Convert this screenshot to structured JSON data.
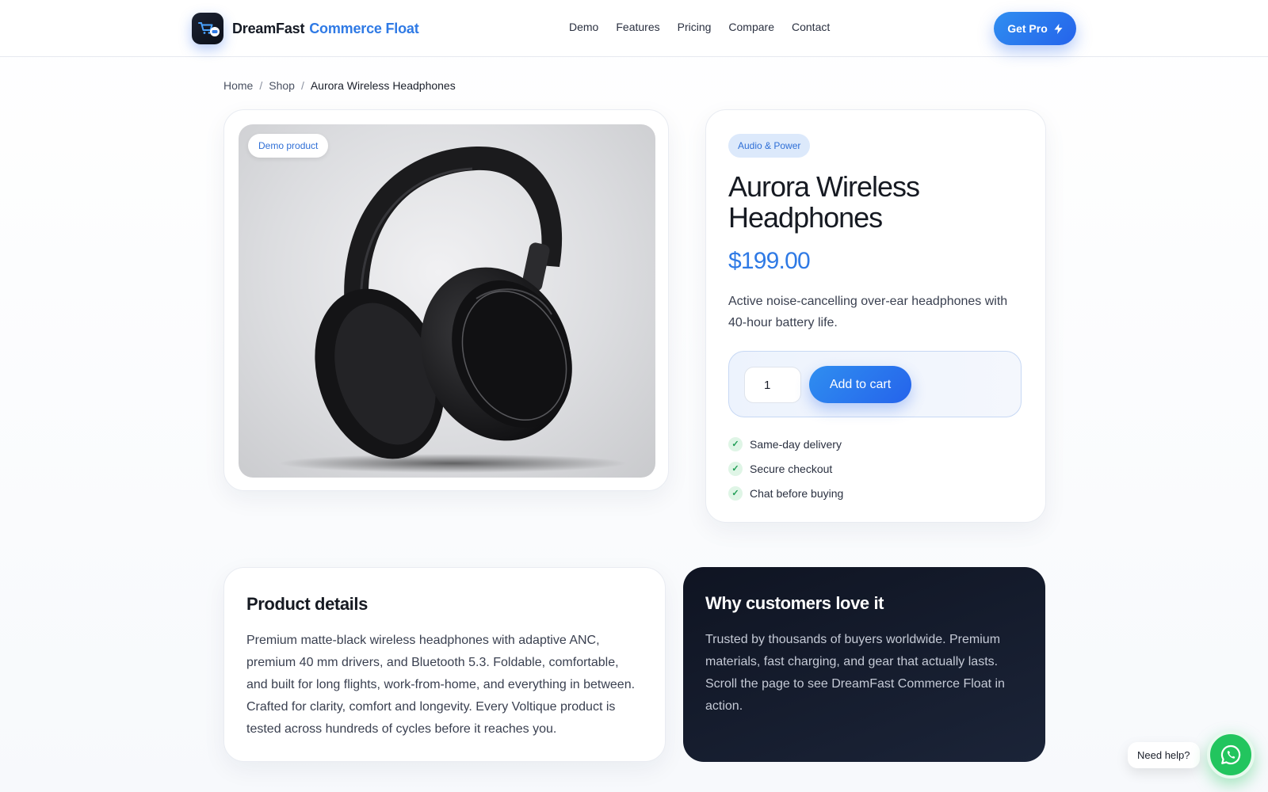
{
  "header": {
    "brand_primary": "DreamFast",
    "brand_accent": "Commerce Float",
    "nav": [
      "Demo",
      "Features",
      "Pricing",
      "Compare",
      "Contact"
    ],
    "cta_label": "Get Pro"
  },
  "breadcrumb": {
    "items": [
      "Home",
      "Shop",
      "Aurora Wireless Headphones"
    ],
    "separator": "/"
  },
  "product": {
    "badge": "Demo product",
    "category": "Audio & Power",
    "title": "Aurora Wireless Headphones",
    "price": "$199.00",
    "description": "Active noise-cancelling over-ear headphones with 40-hour battery life.",
    "quantity": "1",
    "add_to_cart_label": "Add to cart",
    "perks": [
      "Same-day delivery",
      "Secure checkout",
      "Chat before buying"
    ]
  },
  "details": {
    "title": "Product details",
    "paragraph1": "Premium matte-black wireless headphones with adaptive ANC, premium 40 mm drivers, and Bluetooth 5.3. Foldable, comfortable, and built for long flights, work-from-home, and everything in between.",
    "paragraph2": "Crafted for clarity, comfort and longevity. Every Voltique product is tested across hundreds of cycles before it reaches you."
  },
  "why": {
    "title": "Why customers love it",
    "text": "Trusted by thousands of buyers worldwide. Premium materials, fast charging, and gear that actually lasts. Scroll the page to see DreamFast Commerce Float in action."
  },
  "help": {
    "label": "Need help?"
  },
  "colors": {
    "accent": "#2f7ae5",
    "dark_card": "#141a2a",
    "whatsapp": "#22c55e"
  },
  "icons": {
    "logo": "cart-chat-icon",
    "cta": "lightning-icon",
    "perk": "check-icon",
    "help": "whatsapp-icon"
  }
}
